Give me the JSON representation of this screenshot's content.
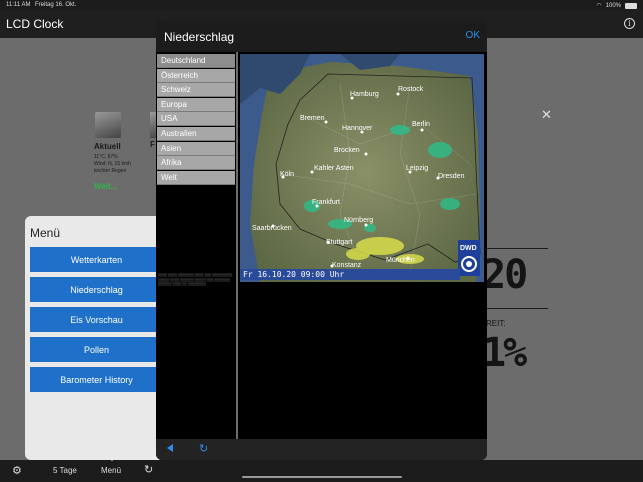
{
  "status_bar": {
    "time": "11:11 AM",
    "date": "Freitag 16. Okt.",
    "battery": "100%"
  },
  "app": {
    "title": "LCD Clock"
  },
  "background": {
    "current_weather": {
      "label": "Aktuell",
      "detail_line1": "11°C, 87%",
      "detail_line2": "Wind: N, 15 kmh",
      "detail_line3": "leichter Regen",
      "more_link": "Welt..."
    },
    "second_label_fragment": "F",
    "lcd_time_fragment": "20",
    "lcd_sub_fragment": "REIT:",
    "lcd_percent_fragment": "1%"
  },
  "menu": {
    "title": "Menü",
    "items": [
      "Wetterkarten",
      "Niederschlag",
      "Eis Vorschau",
      "Pollen",
      "Barometer History"
    ]
  },
  "modal": {
    "title": "Niederschlag",
    "ok_label": "OK",
    "regions": [
      "Deutschland",
      "Österreich",
      "Schweiz",
      "Europa",
      "USA",
      "Australien",
      "Asien",
      "Afrika",
      "Welt"
    ],
    "selected_region": "Deutschland",
    "map_timestamp": "Fr 16.10.20  09:00 Uhr",
    "map_logo": "DWD",
    "cities": [
      "Hamburg",
      "Rostock",
      "Bremen",
      "Hannover",
      "Berlin",
      "Brocken",
      "Köln",
      "Kahler Asten",
      "Leipzig",
      "Dresden",
      "Frankfurt",
      "Nürnberg",
      "Saarbrücken",
      "Stuttgart",
      "München",
      "Konstanz"
    ]
  },
  "tabbar": {
    "tab_5tage": "5 Tage",
    "tab_menu": "Menü"
  },
  "colors": {
    "accent_blue": "#2a8ff0",
    "menu_button": "#1e70c8",
    "link_green": "#2fb54a"
  }
}
